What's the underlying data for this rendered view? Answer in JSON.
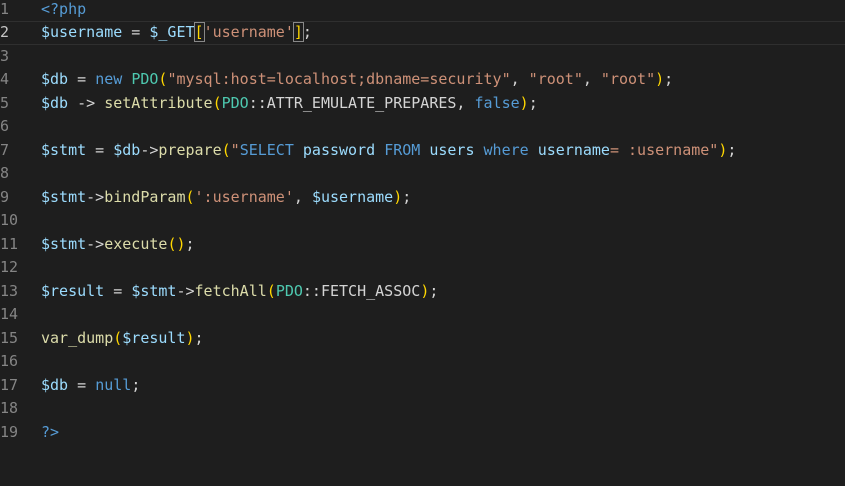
{
  "editor": {
    "lines": [
      {
        "num": "1",
        "tokens": [
          {
            "t": "<?php",
            "c": "kw"
          }
        ]
      },
      {
        "num": "2",
        "current": true,
        "tokens": [
          {
            "t": "$username",
            "c": "var"
          },
          {
            "t": " = ",
            "c": "op"
          },
          {
            "t": "$_GET",
            "c": "var"
          },
          {
            "t": "[",
            "c": "p1 bmatch"
          },
          {
            "t": "'username'",
            "c": "str"
          },
          {
            "t": "]",
            "c": "p1 bmatch"
          },
          {
            "t": ";",
            "c": "op"
          }
        ]
      },
      {
        "num": "3",
        "tokens": []
      },
      {
        "num": "4",
        "tokens": [
          {
            "t": "$db",
            "c": "var"
          },
          {
            "t": " = ",
            "c": "op"
          },
          {
            "t": "new",
            "c": "kw"
          },
          {
            "t": " ",
            "c": "op"
          },
          {
            "t": "PDO",
            "c": "cls"
          },
          {
            "t": "(",
            "c": "p1"
          },
          {
            "t": "\"mysql:host=localhost;dbname=security\"",
            "c": "str"
          },
          {
            "t": ", ",
            "c": "op"
          },
          {
            "t": "\"root\"",
            "c": "str"
          },
          {
            "t": ", ",
            "c": "op"
          },
          {
            "t": "\"root\"",
            "c": "str"
          },
          {
            "t": ")",
            "c": "p1"
          },
          {
            "t": ";",
            "c": "op"
          }
        ]
      },
      {
        "num": "5",
        "tokens": [
          {
            "t": "$db",
            "c": "var"
          },
          {
            "t": " -> ",
            "c": "op"
          },
          {
            "t": "setAttribute",
            "c": "fn"
          },
          {
            "t": "(",
            "c": "p1"
          },
          {
            "t": "PDO",
            "c": "cls"
          },
          {
            "t": "::ATTR_EMULATE_PREPARES, ",
            "c": "op"
          },
          {
            "t": "false",
            "c": "kw"
          },
          {
            "t": ")",
            "c": "p1"
          },
          {
            "t": ";",
            "c": "op"
          }
        ]
      },
      {
        "num": "6",
        "tokens": []
      },
      {
        "num": "7",
        "tokens": [
          {
            "t": "$stmt",
            "c": "var"
          },
          {
            "t": " = ",
            "c": "op"
          },
          {
            "t": "$db",
            "c": "var"
          },
          {
            "t": "->",
            "c": "op"
          },
          {
            "t": "prepare",
            "c": "fn"
          },
          {
            "t": "(",
            "c": "p1"
          },
          {
            "t": "\"",
            "c": "str"
          },
          {
            "t": "SELECT",
            "c": "sqlkw"
          },
          {
            "t": " password ",
            "c": "var"
          },
          {
            "t": "FROM",
            "c": "sqlkw"
          },
          {
            "t": " users ",
            "c": "var"
          },
          {
            "t": "where",
            "c": "sqlkw"
          },
          {
            "t": " username",
            "c": "var"
          },
          {
            "t": "= :username\"",
            "c": "str"
          },
          {
            "t": ")",
            "c": "p1"
          },
          {
            "t": ";",
            "c": "op"
          }
        ]
      },
      {
        "num": "8",
        "tokens": []
      },
      {
        "num": "9",
        "tokens": [
          {
            "t": "$stmt",
            "c": "var"
          },
          {
            "t": "->",
            "c": "op"
          },
          {
            "t": "bindParam",
            "c": "fn"
          },
          {
            "t": "(",
            "c": "p1"
          },
          {
            "t": "':username'",
            "c": "str"
          },
          {
            "t": ", ",
            "c": "op"
          },
          {
            "t": "$username",
            "c": "var"
          },
          {
            "t": ")",
            "c": "p1"
          },
          {
            "t": ";",
            "c": "op"
          }
        ]
      },
      {
        "num": "10",
        "tokens": []
      },
      {
        "num": "11",
        "tokens": [
          {
            "t": "$stmt",
            "c": "var"
          },
          {
            "t": "->",
            "c": "op"
          },
          {
            "t": "execute",
            "c": "fn"
          },
          {
            "t": "()",
            "c": "p1"
          },
          {
            "t": ";",
            "c": "op"
          }
        ]
      },
      {
        "num": "12",
        "tokens": []
      },
      {
        "num": "13",
        "tokens": [
          {
            "t": "$result",
            "c": "var"
          },
          {
            "t": " = ",
            "c": "op"
          },
          {
            "t": "$stmt",
            "c": "var"
          },
          {
            "t": "->",
            "c": "op"
          },
          {
            "t": "fetchAll",
            "c": "fn"
          },
          {
            "t": "(",
            "c": "p1"
          },
          {
            "t": "PDO",
            "c": "cls"
          },
          {
            "t": "::FETCH_ASSOC",
            "c": "op"
          },
          {
            "t": ")",
            "c": "p1"
          },
          {
            "t": ";",
            "c": "op"
          }
        ]
      },
      {
        "num": "14",
        "tokens": []
      },
      {
        "num": "15",
        "tokens": [
          {
            "t": "var_dump",
            "c": "fn"
          },
          {
            "t": "(",
            "c": "p1"
          },
          {
            "t": "$result",
            "c": "var"
          },
          {
            "t": ")",
            "c": "p1"
          },
          {
            "t": ";",
            "c": "op"
          }
        ]
      },
      {
        "num": "16",
        "tokens": []
      },
      {
        "num": "17",
        "tokens": [
          {
            "t": "$db",
            "c": "var"
          },
          {
            "t": " = ",
            "c": "op"
          },
          {
            "t": "null",
            "c": "kw"
          },
          {
            "t": ";",
            "c": "op"
          }
        ]
      },
      {
        "num": "18",
        "tokens": []
      },
      {
        "num": "19",
        "tokens": [
          {
            "t": "?>",
            "c": "kw"
          }
        ]
      }
    ]
  },
  "colors": {
    "background": "#1e1e1e",
    "keyword": "#569cd6",
    "variable": "#9cdcfe",
    "string": "#ce9178",
    "function": "#dcdcaa",
    "class": "#4ec9b0",
    "bracket": "#ffd700",
    "line_number": "#858585"
  }
}
